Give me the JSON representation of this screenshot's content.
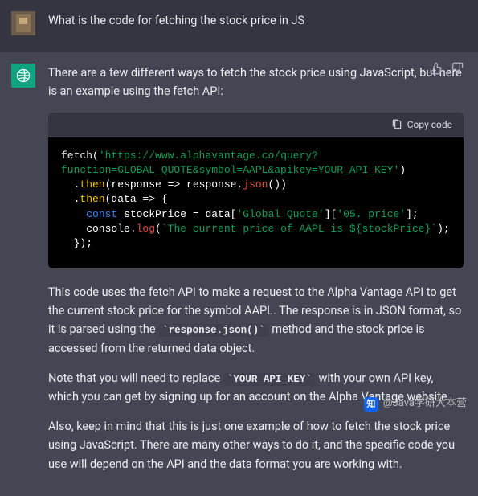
{
  "user": {
    "prompt": "What is the code for fetching the stock price in JS"
  },
  "assistant": {
    "intro": "There are a few different ways to fetch the stock price using JavaScript, but here is an example using the fetch API:",
    "code": {
      "copy_label": "Copy code",
      "line1_fn": "fetch",
      "line1_open": "(",
      "line1_url_a": "'https://www.alphavantage.co/query?",
      "line2_url_b": "function=GLOBAL_QUOTE&symbol=AAPL&apikey=YOUR_API_KEY'",
      "line2_close": ")",
      "line3_pre": "  .",
      "line3_then": "then",
      "line3_rest_a": "(response => response.",
      "line3_json": "json",
      "line3_rest_b": "())",
      "line4_pre": "  .",
      "line4_then": "then",
      "line4_rest": "(data => {",
      "line5_indent": "    ",
      "line5_kw": "const",
      "line5_mid": " stockPrice = data[",
      "line5_key1": "'Global Quote'",
      "line5_mid2": "][",
      "line5_key2": "'05. price'",
      "line5_end": "];",
      "line6_indent": "    console.",
      "line6_log": "log",
      "line6_open": "(",
      "line6_tpl": "`The current price of AAPL is ${stockPrice}`",
      "line6_close": ");",
      "line7": "  });"
    },
    "para2_a": "This code uses the fetch API to make a request to the Alpha Vantage API to get the current stock price for the symbol AAPL. The response is in JSON format, so it is parsed using the ",
    "para2_code": "`response.json()`",
    "para2_b": " method and the stock price is accessed from the returned data object.",
    "para3_a": "Note that you will need to replace ",
    "para3_code": "`YOUR_API_KEY`",
    "para3_b": " with your own API key, which you can get by signing up for an account on the Alpha Vantage website.",
    "para4": "Also, keep in mind that this is just one example of how to fetch the stock price using JavaScript. There are many other ways to do it, and the specific code you use will depend on the API and the data format you are working with."
  },
  "watermark": {
    "logo": "知",
    "text": "@Java学研大本营"
  }
}
